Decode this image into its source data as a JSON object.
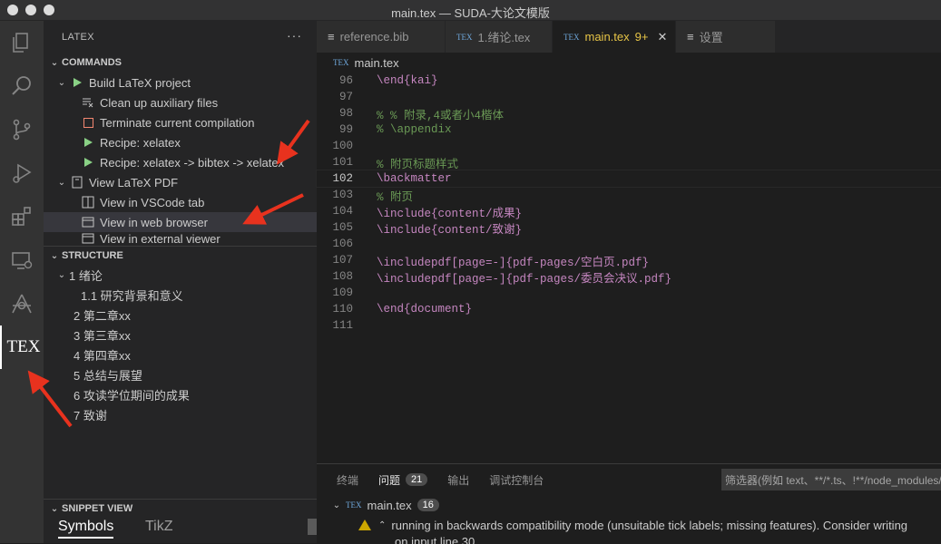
{
  "window": {
    "title": "main.tex — SUDA-大论文模版"
  },
  "sidebar": {
    "title": "LATEX",
    "more": "···",
    "commands_header": "COMMANDS",
    "commands": [
      {
        "label": "Build LaTeX project"
      },
      {
        "label": "Clean up auxiliary files"
      },
      {
        "label": "Terminate current compilation"
      },
      {
        "label": "Recipe: xelatex"
      },
      {
        "label": "Recipe: xelatex -> bibtex -> xelatex"
      },
      {
        "label": "View LaTeX PDF"
      },
      {
        "label": "View in VSCode tab"
      },
      {
        "label": "View in web browser"
      },
      {
        "label": "View in external viewer"
      }
    ],
    "structure_header": "STRUCTURE",
    "structure": [
      {
        "label": "1 绪论"
      },
      {
        "label": "1.1 研究背景和意义"
      },
      {
        "label": "2 第二章xx"
      },
      {
        "label": "3 第三章xx"
      },
      {
        "label": "4 第四章xx"
      },
      {
        "label": "5 总结与展望"
      },
      {
        "label": "6 攻读学位期间的成果"
      },
      {
        "label": "7 致谢"
      }
    ],
    "snippet_header": "SNIPPET VIEW",
    "snippet_tabs": [
      "Symbols",
      "TikZ"
    ]
  },
  "activity": {
    "tex_label": "TEX"
  },
  "tabs": [
    {
      "label": "reference.bib",
      "icon": "list-icon"
    },
    {
      "label": "1.绪论.tex",
      "icon": "tex-icon"
    },
    {
      "label": "main.tex",
      "badge": "9+",
      "icon": "tex-icon"
    },
    {
      "label": "设置",
      "icon": "list-icon"
    }
  ],
  "tex_icon_text": "TEX",
  "breadcrumb": {
    "file": "main.tex"
  },
  "code": [
    {
      "n": "96",
      "text": "\\end{kai}"
    },
    {
      "n": "97",
      "text": ""
    },
    {
      "n": "98",
      "text": "% % 附录,4或者小4楷体"
    },
    {
      "n": "99",
      "text": "% \\appendix"
    },
    {
      "n": "100",
      "text": ""
    },
    {
      "n": "101",
      "text": "% 附页标题样式"
    },
    {
      "n": "102",
      "text": "\\backmatter"
    },
    {
      "n": "103",
      "text": "% 附页"
    },
    {
      "n": "104",
      "text": "\\include{content/成果}"
    },
    {
      "n": "105",
      "text": "\\include{content/致谢}"
    },
    {
      "n": "106",
      "text": ""
    },
    {
      "n": "107",
      "text": "\\includepdf[page=-]{pdf-pages/空白页.pdf}"
    },
    {
      "n": "108",
      "text": "\\includepdf[page=-]{pdf-pages/委员会决议.pdf}"
    },
    {
      "n": "109",
      "text": ""
    },
    {
      "n": "110",
      "text": "\\end{document}"
    },
    {
      "n": "111",
      "text": ""
    }
  ],
  "panel": {
    "tabs": [
      {
        "label": "终端"
      },
      {
        "label": "问题",
        "badge": "21"
      },
      {
        "label": "输出"
      },
      {
        "label": "调试控制台"
      }
    ],
    "filter_placeholder": "筛选器(例如 text、**/*.ts、!**/node_modules/**)",
    "file": "main.tex",
    "file_badge": "16",
    "warning": "running in backwards compatibility mode (unsuitable tick labels; missing features). Consider writing",
    "warning_cont": "on input line 30."
  },
  "colors": {
    "accent": "#e7c547",
    "green": "#89d185",
    "red": "#f48771",
    "annotation": "#e8321e"
  }
}
